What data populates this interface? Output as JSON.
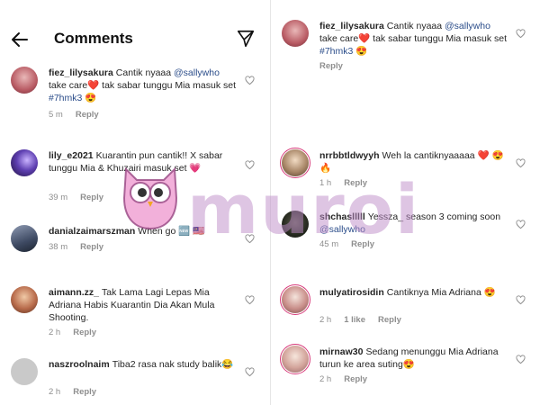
{
  "header": {
    "title": "Comments",
    "back_icon": "arrow-left-icon",
    "share_icon": "send-icon"
  },
  "left": [
    {
      "username": "fiez_lilysakura",
      "parts": [
        "Cantik nyaaa ",
        "@sallywho",
        " take care❤️ tak sabar tunggu Mia masuk set ",
        "#7hmk3",
        " 😍"
      ],
      "time": "5 m",
      "likes": "",
      "reply": "Reply"
    },
    {
      "username": "lily_e2021",
      "parts": [
        "Kuarantin pun cantik!! X sabar tunggu Mia & Khuzairi masuk set 💗"
      ],
      "time": "39 m",
      "likes": "",
      "reply": "Reply"
    },
    {
      "username": "danialzaimarszman",
      "parts": [
        "When go 🆕 🇲🇾"
      ],
      "time": "38 m",
      "likes": "",
      "reply": "Reply"
    },
    {
      "username": "aimann.zz_",
      "parts": [
        "Tak Lama Lagi Lepas Mia Adriana Habis Kuarantin Dia Akan Mula Shooting."
      ],
      "time": "2 h",
      "likes": "",
      "reply": "Reply"
    },
    {
      "username": "naszroolnaim",
      "parts": [
        "Tiba2 rasa nak study balik😂"
      ],
      "time": "2 h",
      "likes": "",
      "reply": "Reply"
    }
  ],
  "right": [
    {
      "username": "fiez_lilysakura",
      "parts": [
        "Cantik nyaaa ",
        "@sallywho",
        " take care❤️ tak sabar tunggu Mia masuk set ",
        "#7hmk3",
        " 😍"
      ],
      "time": "",
      "likes": "",
      "reply": "Reply"
    },
    {
      "username": "nrrbbtldwyyh",
      "parts": [
        "Weh la cantiknyaaaaa ❤️ 😍🔥"
      ],
      "time": "1 h",
      "likes": "",
      "reply": "Reply"
    },
    {
      "username": "shchaslllll",
      "parts": [
        "Yessza_ season 3 coming soon ",
        "@sallywho"
      ],
      "time": "45 m",
      "likes": "",
      "reply": "Reply"
    },
    {
      "username": "mulyatirosidin",
      "parts": [
        "Cantiknya Mia Adriana 😍"
      ],
      "time": "2 h",
      "likes": "1 like",
      "reply": "Reply"
    },
    {
      "username": "mirnaw30",
      "parts": [
        "Sedang menunggu Mia Adriana turun ke area suting😍"
      ],
      "time": "2 h",
      "likes": "",
      "reply": "Reply"
    }
  ],
  "watermark": {
    "text": "muroi"
  },
  "colors": {
    "mention": "#2b4d8a",
    "meta": "#8e8e8e",
    "story_ring": "#d73a7a"
  }
}
